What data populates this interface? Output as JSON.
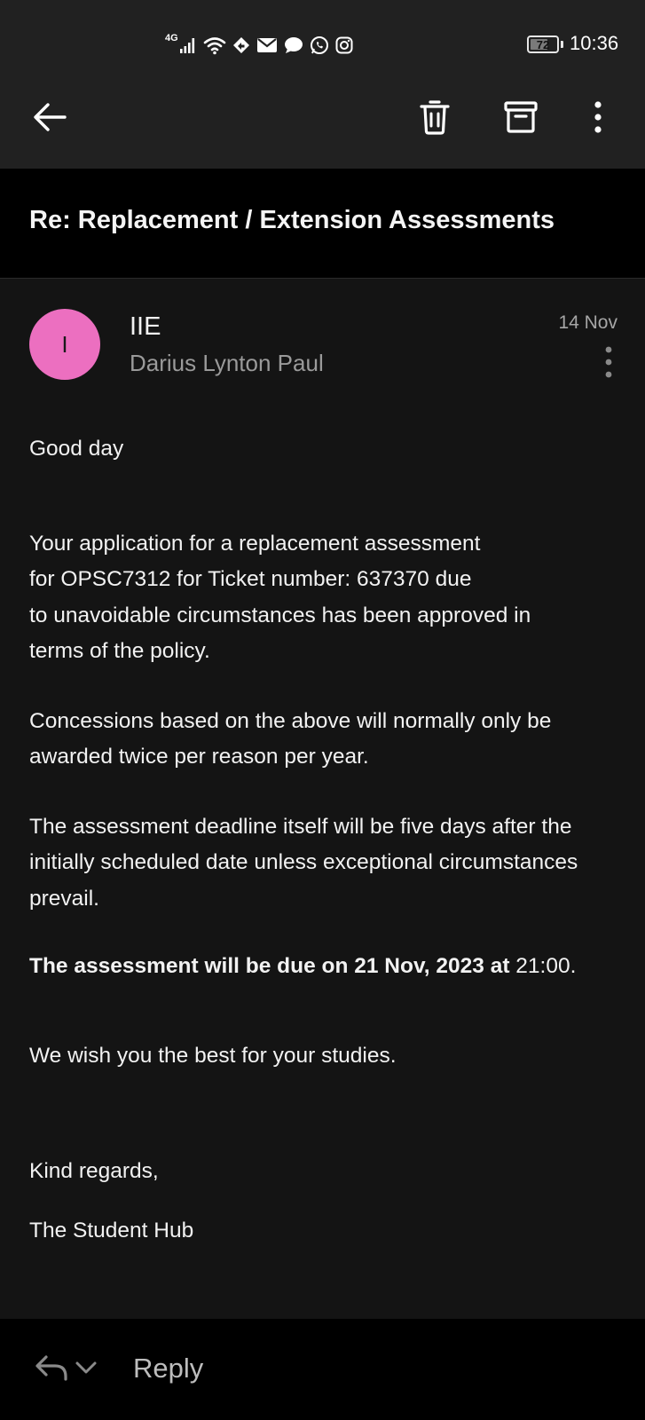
{
  "status_bar": {
    "network": "4G",
    "icons": [
      "signal-icon",
      "wifi-icon",
      "location-share-icon",
      "mail-notification-icon",
      "message-notification-icon",
      "whatsapp-icon",
      "instagram-icon"
    ],
    "battery_level": "72",
    "time": "10:36"
  },
  "toolbar": {
    "back_icon": "arrow-left-icon",
    "delete_icon": "trash-icon",
    "archive_icon": "archive-icon",
    "more_icon": "more-vertical-icon"
  },
  "email": {
    "subject": "Re: Replacement / Extension Assessments",
    "avatar_letter": "I",
    "avatar_color": "#ec6fc0",
    "sender": "IIE",
    "recipient": "Darius Lynton Paul",
    "date": "14 Nov",
    "body": {
      "greeting": "Good day",
      "application": "Your application for a replacement assessment for OPSC7312 for Ticket number: 637370 due to unavoidable circumstances has been approved in terms of the policy.",
      "application_lines": [
        "Your application for a replacement assessment",
        "for OPSC7312 for Ticket number: 637370 due",
        "to unavoidable circumstances has been approved in",
        "terms of the policy."
      ],
      "concessions": "Concessions based on the above will normally only be awarded twice per reason per year.",
      "deadline": "The assessment deadline itself will be five days after the initially scheduled date unless exceptional circumstances prevail.",
      "due_bold": "The assessment will be due on 21 Nov, 2023 at",
      "due_time": " 21:00.",
      "wish": "We wish you the best for your studies.",
      "regards": "Kind regards,",
      "signature": "The Student Hub"
    }
  },
  "reply_bar": {
    "label": "Reply"
  },
  "colors": {
    "bar_background": "#212121",
    "message_background": "#141414",
    "page_background": "#000000"
  }
}
